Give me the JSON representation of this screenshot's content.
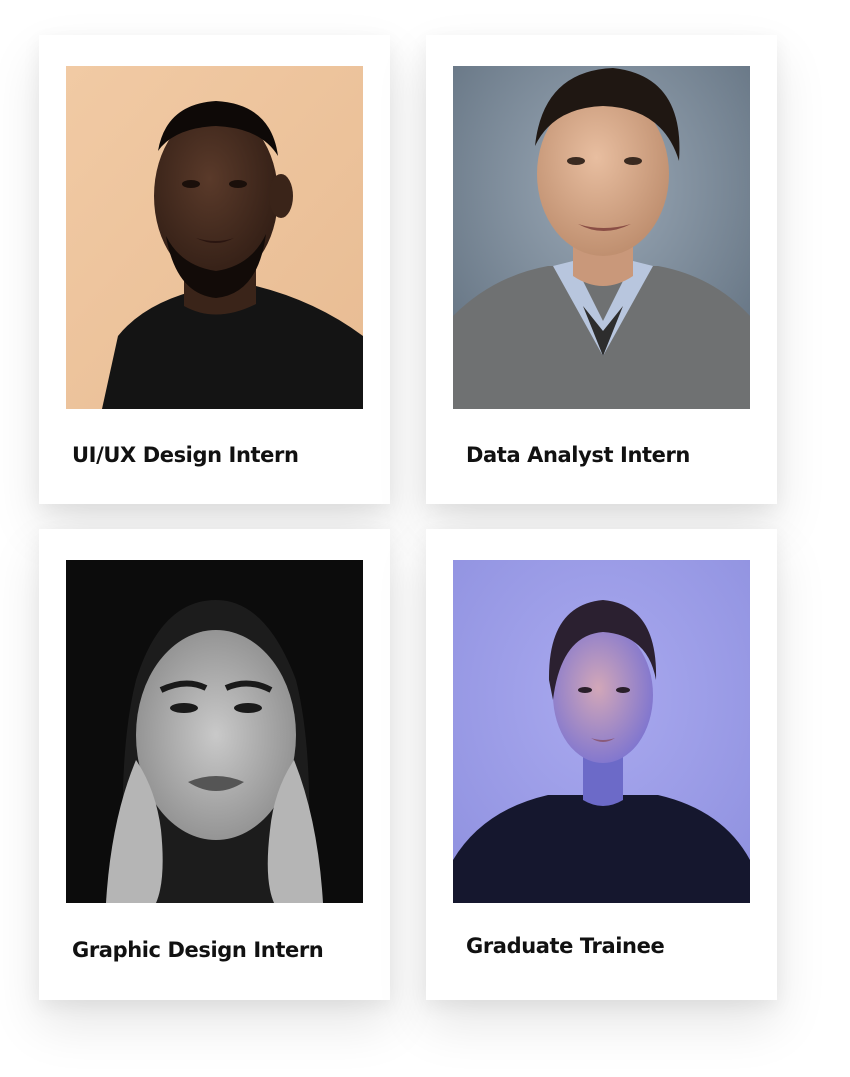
{
  "cards": [
    {
      "title": "UI/UX Design Intern",
      "background": "#efc8a2"
    },
    {
      "title": "Data Analyst Intern",
      "background": "#7d8ea0"
    },
    {
      "title": "Graphic Design Intern",
      "background": "#2a2a2a"
    },
    {
      "title": "Graduate Trainee",
      "background": "#9a9be6"
    }
  ]
}
